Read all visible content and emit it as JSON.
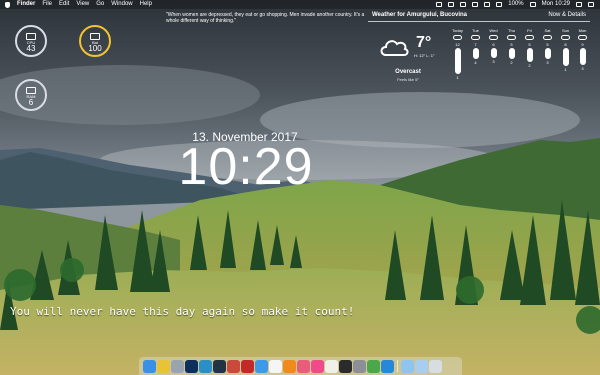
{
  "menubar": {
    "app_name": "Finder",
    "menus": [
      "File",
      "Edit",
      "View",
      "Go",
      "Window",
      "Help"
    ],
    "battery": "100%",
    "clock": "Mon 10:29"
  },
  "quote_top": "\"When women are depressed, they eat or go shopping. Men invade another country. It's a whole different way of thinking.\"",
  "gauges": {
    "cpu": {
      "label": "CPU",
      "value": "43"
    },
    "battery": {
      "label": "Bat",
      "value": "100"
    },
    "ram": {
      "label": "RAM",
      "value": "6"
    }
  },
  "weather": {
    "header_location": "Weather for Amurgului, Bucovina",
    "header_link": "Now & Details",
    "current_temp": "7°",
    "high_low": "H: 12° L: 1°",
    "condition": "Overcast",
    "sub": "Feels like 5°",
    "days": [
      {
        "name": "Today",
        "hi": "12",
        "lo": "1",
        "fill": 0.9
      },
      {
        "name": "Tue",
        "hi": "7",
        "lo": "4",
        "fill": 0.3
      },
      {
        "name": "Wed",
        "hi": "6",
        "lo": "3",
        "fill": 0.25
      },
      {
        "name": "Thu",
        "hi": "5",
        "lo": "2",
        "fill": 0.3
      },
      {
        "name": "Fri",
        "hi": "5",
        "lo": "2",
        "fill": 0.4
      },
      {
        "name": "Sat",
        "hi": "5",
        "lo": "3",
        "fill": 0.3
      },
      {
        "name": "Sun",
        "hi": "8",
        "lo": "1",
        "fill": 0.6
      },
      {
        "name": "Mon",
        "hi": "9",
        "lo": "3",
        "fill": 0.55
      }
    ]
  },
  "date": "13. November 2017",
  "time": "10:29",
  "motto": "You will never have this day again so make it count! ",
  "dock": {
    "apps": [
      {
        "name": "finder-icon",
        "color": "#3a8fe6"
      },
      {
        "name": "chrome-icon",
        "color": "#e8c33a"
      },
      {
        "name": "launchpad-icon",
        "color": "#9aa4ad"
      },
      {
        "name": "photoshop-icon",
        "color": "#0c2f5c"
      },
      {
        "name": "kodi-icon",
        "color": "#2a8fc5"
      },
      {
        "name": "terminal-icon",
        "color": "#223344"
      },
      {
        "name": "popcorn-icon",
        "color": "#c94a3a"
      },
      {
        "name": "transmission-icon",
        "color": "#c22a2a"
      },
      {
        "name": "safari-icon",
        "color": "#3e9ae8"
      },
      {
        "name": "calendar-icon",
        "color": "#f5f5f5"
      },
      {
        "name": "vlc-icon",
        "color": "#f08a1c"
      },
      {
        "name": "photos-icon",
        "color": "#e85e7a"
      },
      {
        "name": "itunes-icon",
        "color": "#f04a8a"
      },
      {
        "name": "textedit-icon",
        "color": "#f0efe8"
      },
      {
        "name": "console-icon",
        "color": "#2b2b2b"
      },
      {
        "name": "system-prefs-icon",
        "color": "#8c9096"
      },
      {
        "name": "utorrent-icon",
        "color": "#4aa84a"
      },
      {
        "name": "store-icon",
        "color": "#2a86d8"
      }
    ],
    "right": [
      {
        "name": "folder-icon",
        "color": "#8fc4ee"
      },
      {
        "name": "downloads-icon",
        "color": "#a8cdee"
      },
      {
        "name": "trash-icon",
        "color": "#d8dde2"
      }
    ]
  }
}
